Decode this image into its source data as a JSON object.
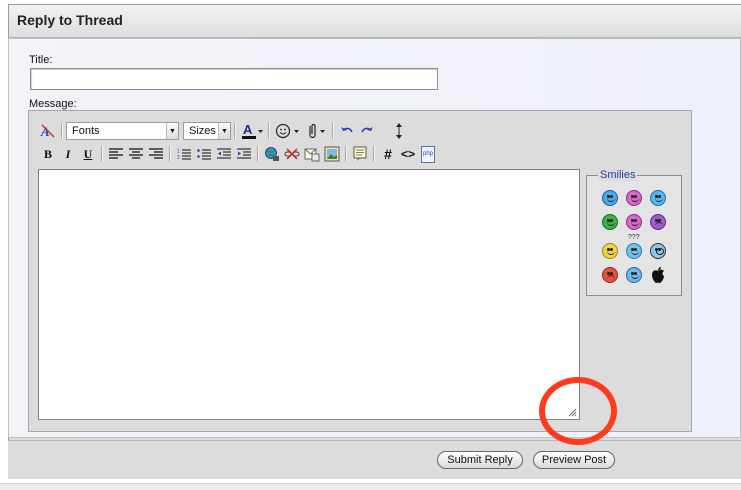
{
  "panel": {
    "title": "Reply to Thread"
  },
  "form": {
    "title_label": "Title:",
    "title_value": "",
    "message_label": "Message:",
    "message_value": ""
  },
  "toolbar": {
    "fonts_label": "Fonts",
    "sizes_label": "Sizes",
    "bold": "B",
    "italic": "I",
    "underline": "U",
    "hash": "#",
    "code": "<>",
    "php": "php"
  },
  "smilies": {
    "legend": "Smilies",
    "question_marks": "???",
    "colors": [
      "#4aa8e8",
      "#d468c9",
      "#55b6ea",
      "#39b24a",
      "#d468c9",
      "#9b5bd1",
      "#f1d63a",
      "#6fc1ee",
      "#8fc7ec",
      "#e5533f",
      "#6fb7ea",
      "#222222"
    ]
  },
  "buttons": {
    "submit": "Submit Reply",
    "preview": "Preview Post"
  },
  "colors": {
    "annotation": "#ff3b1f",
    "legend_text": "#1f3aa6"
  }
}
